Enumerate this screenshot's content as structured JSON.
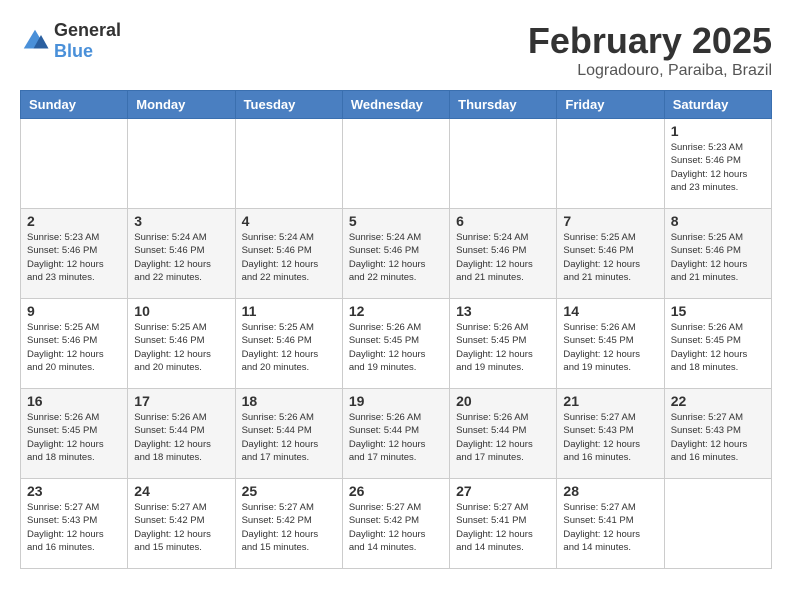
{
  "logo": {
    "general": "General",
    "blue": "Blue"
  },
  "header": {
    "month": "February 2025",
    "location": "Logradouro, Paraiba, Brazil"
  },
  "days_of_week": [
    "Sunday",
    "Monday",
    "Tuesday",
    "Wednesday",
    "Thursday",
    "Friday",
    "Saturday"
  ],
  "weeks": [
    [
      {
        "day": "",
        "info": ""
      },
      {
        "day": "",
        "info": ""
      },
      {
        "day": "",
        "info": ""
      },
      {
        "day": "",
        "info": ""
      },
      {
        "day": "",
        "info": ""
      },
      {
        "day": "",
        "info": ""
      },
      {
        "day": "1",
        "info": "Sunrise: 5:23 AM\nSunset: 5:46 PM\nDaylight: 12 hours\nand 23 minutes."
      }
    ],
    [
      {
        "day": "2",
        "info": "Sunrise: 5:23 AM\nSunset: 5:46 PM\nDaylight: 12 hours\nand 23 minutes."
      },
      {
        "day": "3",
        "info": "Sunrise: 5:24 AM\nSunset: 5:46 PM\nDaylight: 12 hours\nand 22 minutes."
      },
      {
        "day": "4",
        "info": "Sunrise: 5:24 AM\nSunset: 5:46 PM\nDaylight: 12 hours\nand 22 minutes."
      },
      {
        "day": "5",
        "info": "Sunrise: 5:24 AM\nSunset: 5:46 PM\nDaylight: 12 hours\nand 22 minutes."
      },
      {
        "day": "6",
        "info": "Sunrise: 5:24 AM\nSunset: 5:46 PM\nDaylight: 12 hours\nand 21 minutes."
      },
      {
        "day": "7",
        "info": "Sunrise: 5:25 AM\nSunset: 5:46 PM\nDaylight: 12 hours\nand 21 minutes."
      },
      {
        "day": "8",
        "info": "Sunrise: 5:25 AM\nSunset: 5:46 PM\nDaylight: 12 hours\nand 21 minutes."
      }
    ],
    [
      {
        "day": "9",
        "info": "Sunrise: 5:25 AM\nSunset: 5:46 PM\nDaylight: 12 hours\nand 20 minutes."
      },
      {
        "day": "10",
        "info": "Sunrise: 5:25 AM\nSunset: 5:46 PM\nDaylight: 12 hours\nand 20 minutes."
      },
      {
        "day": "11",
        "info": "Sunrise: 5:25 AM\nSunset: 5:46 PM\nDaylight: 12 hours\nand 20 minutes."
      },
      {
        "day": "12",
        "info": "Sunrise: 5:26 AM\nSunset: 5:45 PM\nDaylight: 12 hours\nand 19 minutes."
      },
      {
        "day": "13",
        "info": "Sunrise: 5:26 AM\nSunset: 5:45 PM\nDaylight: 12 hours\nand 19 minutes."
      },
      {
        "day": "14",
        "info": "Sunrise: 5:26 AM\nSunset: 5:45 PM\nDaylight: 12 hours\nand 19 minutes."
      },
      {
        "day": "15",
        "info": "Sunrise: 5:26 AM\nSunset: 5:45 PM\nDaylight: 12 hours\nand 18 minutes."
      }
    ],
    [
      {
        "day": "16",
        "info": "Sunrise: 5:26 AM\nSunset: 5:45 PM\nDaylight: 12 hours\nand 18 minutes."
      },
      {
        "day": "17",
        "info": "Sunrise: 5:26 AM\nSunset: 5:44 PM\nDaylight: 12 hours\nand 18 minutes."
      },
      {
        "day": "18",
        "info": "Sunrise: 5:26 AM\nSunset: 5:44 PM\nDaylight: 12 hours\nand 17 minutes."
      },
      {
        "day": "19",
        "info": "Sunrise: 5:26 AM\nSunset: 5:44 PM\nDaylight: 12 hours\nand 17 minutes."
      },
      {
        "day": "20",
        "info": "Sunrise: 5:26 AM\nSunset: 5:44 PM\nDaylight: 12 hours\nand 17 minutes."
      },
      {
        "day": "21",
        "info": "Sunrise: 5:27 AM\nSunset: 5:43 PM\nDaylight: 12 hours\nand 16 minutes."
      },
      {
        "day": "22",
        "info": "Sunrise: 5:27 AM\nSunset: 5:43 PM\nDaylight: 12 hours\nand 16 minutes."
      }
    ],
    [
      {
        "day": "23",
        "info": "Sunrise: 5:27 AM\nSunset: 5:43 PM\nDaylight: 12 hours\nand 16 minutes."
      },
      {
        "day": "24",
        "info": "Sunrise: 5:27 AM\nSunset: 5:42 PM\nDaylight: 12 hours\nand 15 minutes."
      },
      {
        "day": "25",
        "info": "Sunrise: 5:27 AM\nSunset: 5:42 PM\nDaylight: 12 hours\nand 15 minutes."
      },
      {
        "day": "26",
        "info": "Sunrise: 5:27 AM\nSunset: 5:42 PM\nDaylight: 12 hours\nand 14 minutes."
      },
      {
        "day": "27",
        "info": "Sunrise: 5:27 AM\nSunset: 5:41 PM\nDaylight: 12 hours\nand 14 minutes."
      },
      {
        "day": "28",
        "info": "Sunrise: 5:27 AM\nSunset: 5:41 PM\nDaylight: 12 hours\nand 14 minutes."
      },
      {
        "day": "",
        "info": ""
      }
    ]
  ]
}
